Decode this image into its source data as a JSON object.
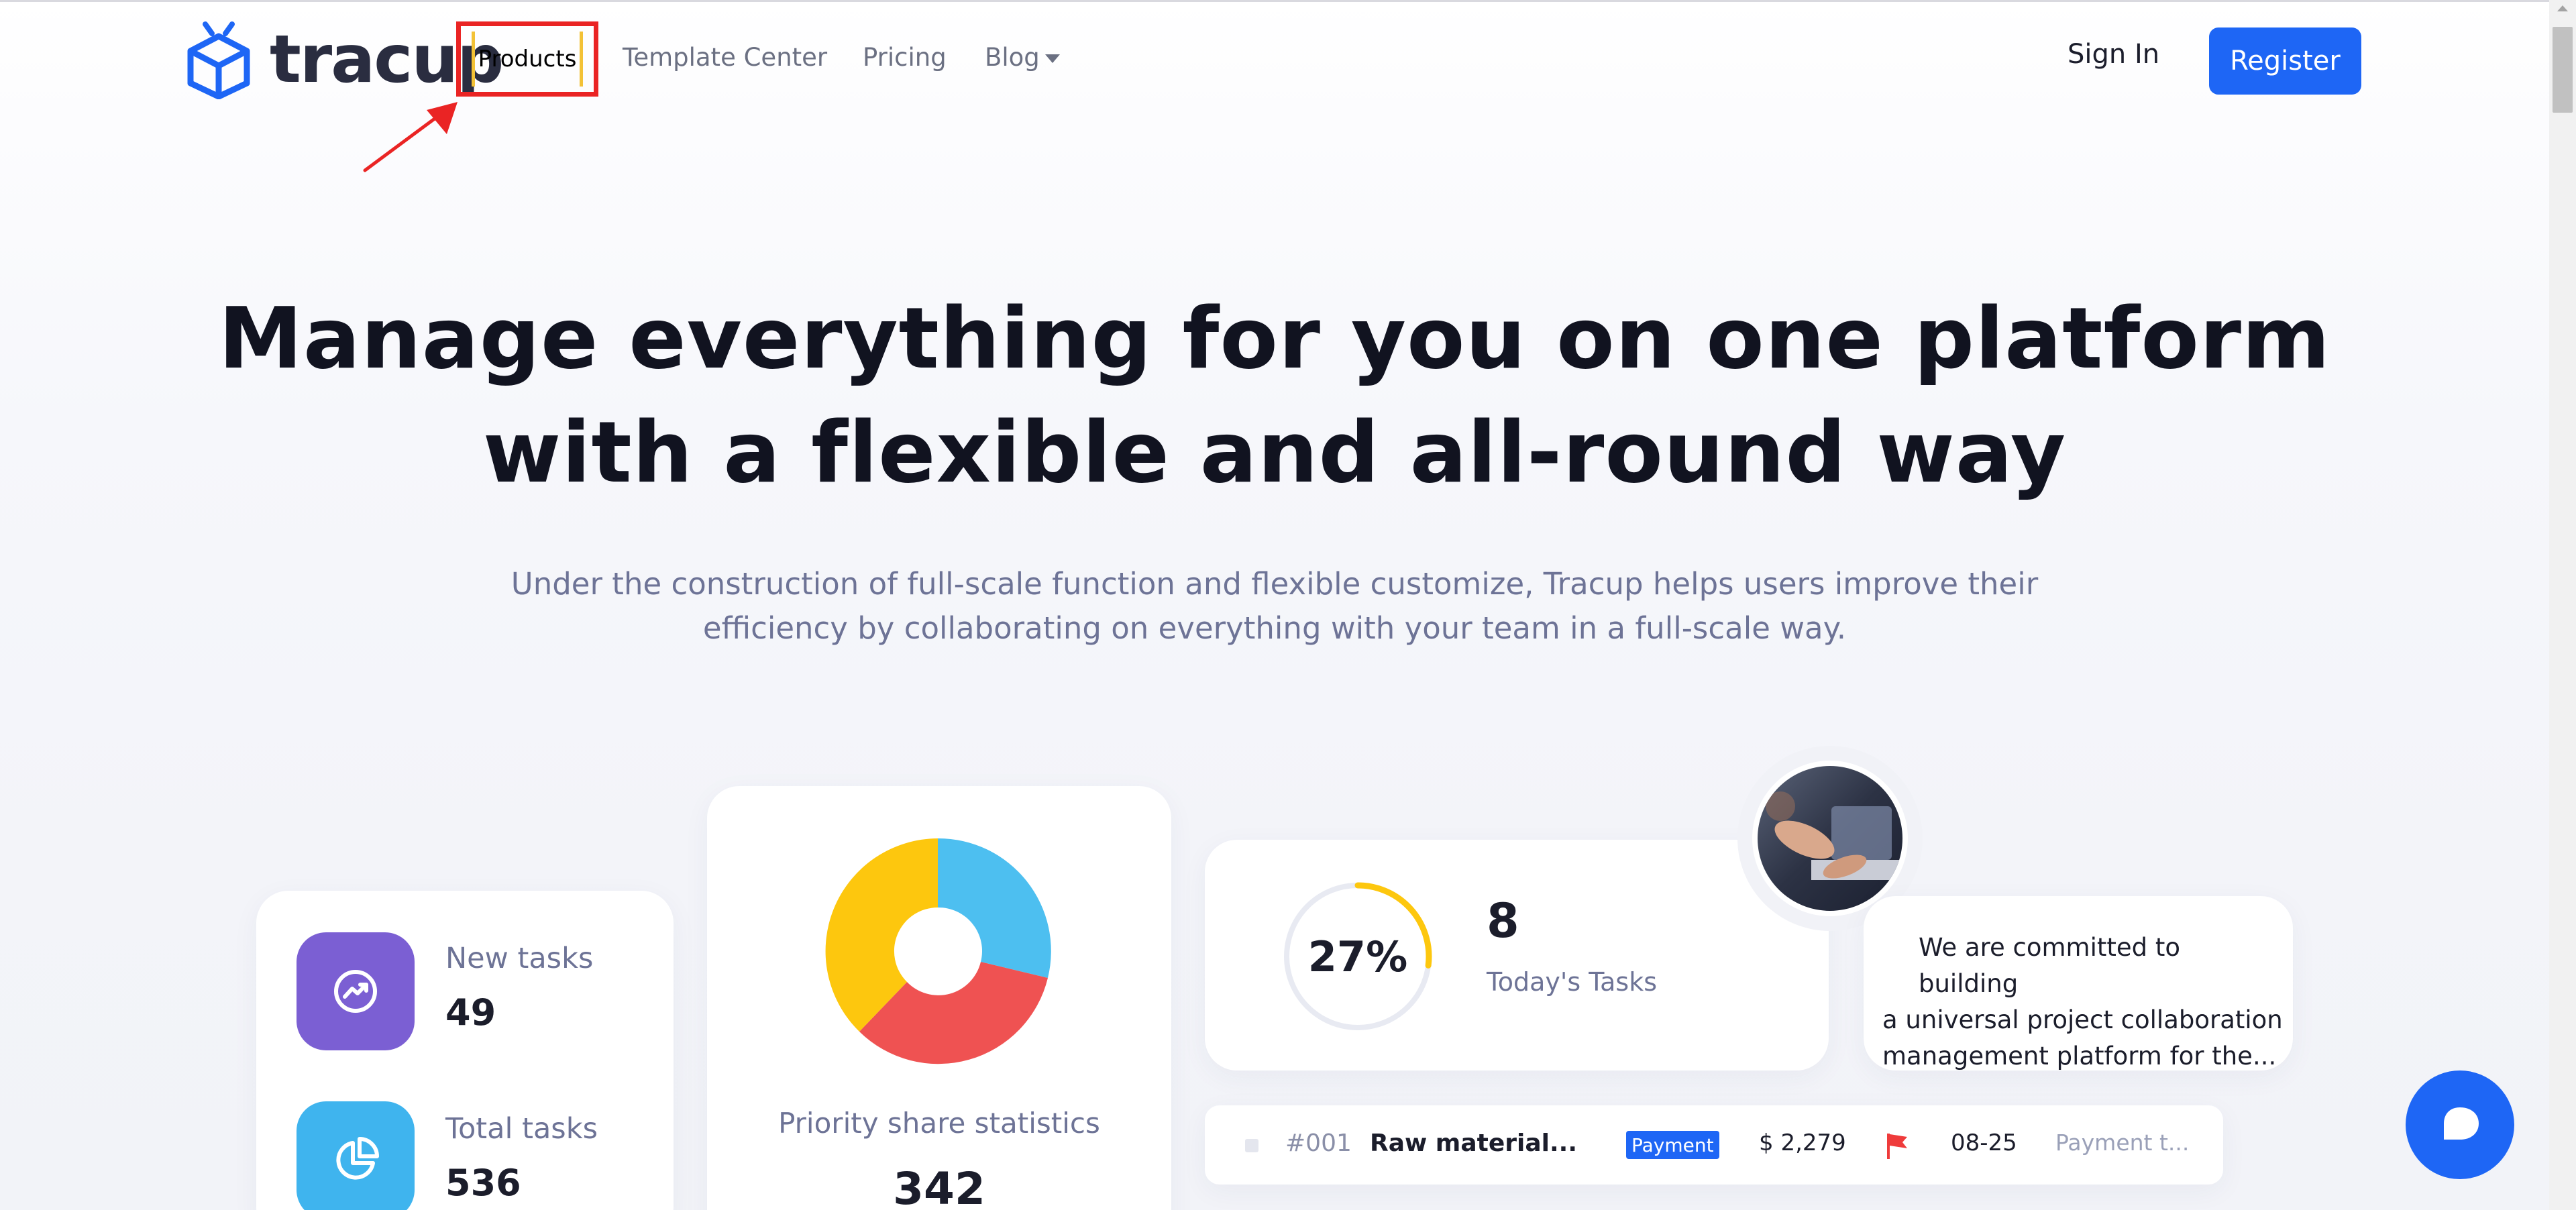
{
  "brand": {
    "name": "tracup"
  },
  "nav": {
    "products": "Products",
    "template_center": "Template Center",
    "pricing": "Pricing",
    "blog": "Blog",
    "sign_in": "Sign In",
    "register": "Register"
  },
  "hero": {
    "title_line1": "Manage everything for you on one platform",
    "title_line2": "with a flexible and all-round way",
    "subtitle_line1": "Under the construction of full-scale function and flexible customize, Tracup helps users improve their",
    "subtitle_line2": "efficiency by collaborating on everything with your team in a full-scale way."
  },
  "stats": {
    "new_tasks_label": "New tasks",
    "new_tasks_value": "49",
    "total_tasks_label": "Total tasks",
    "total_tasks_value": "536"
  },
  "priority": {
    "label": "Priority share statistics",
    "value": "342"
  },
  "today": {
    "percent": "27%",
    "progress_fraction": 0.27,
    "count": "8",
    "label": "Today's Tasks"
  },
  "quote": {
    "line1": "We are committed to building",
    "line2": "a universal project collaboration",
    "line3": "management platform for the..."
  },
  "task_row": {
    "id": "#001",
    "name": "Raw material...",
    "badge": "Payment",
    "amount": "$ 2,279",
    "date": "08-25",
    "status": "Payment t..."
  },
  "colors": {
    "accent": "#1e66f5",
    "highlight_red": "#ea2424",
    "highlight_yellow": "#f3c236",
    "donut_blue": "#4dbff0",
    "donut_red": "#ef5252",
    "donut_yellow": "#fdc70e",
    "purple": "#7b5fd3"
  },
  "icons": {
    "logo": "cube-logo-icon",
    "new_tasks": "trend-up-icon",
    "total_tasks": "pie-chart-icon",
    "chat": "chat-bubble-icon",
    "flag": "flag-icon"
  }
}
